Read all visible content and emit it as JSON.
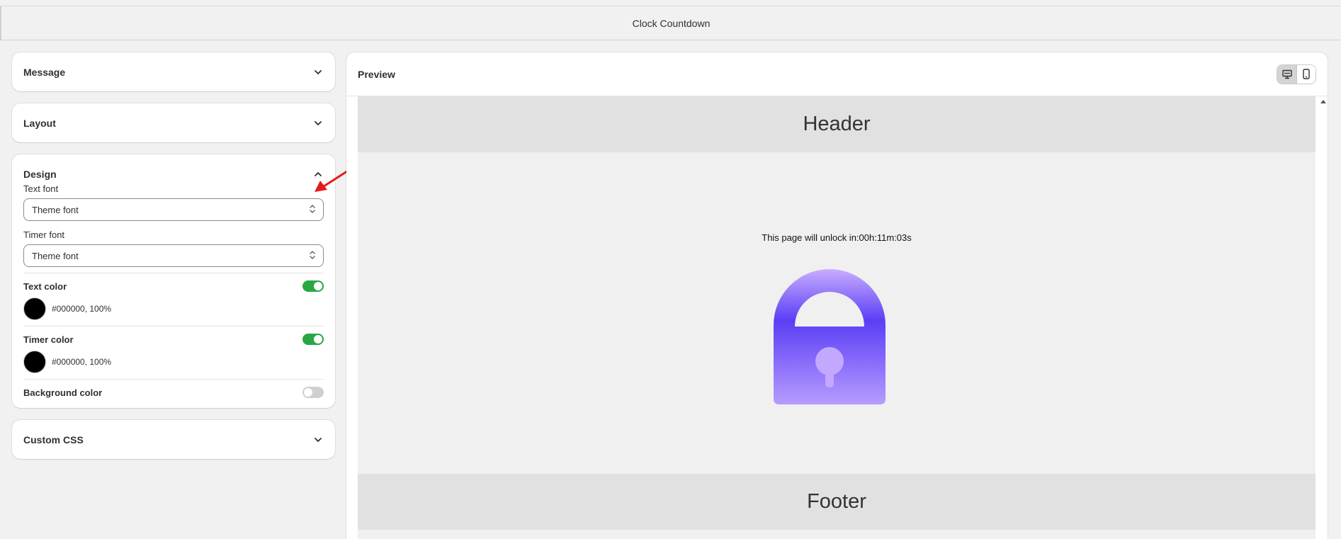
{
  "app": {
    "title": "Clock Countdown"
  },
  "sections": {
    "message": {
      "label": "Message"
    },
    "layout": {
      "label": "Layout"
    },
    "design": {
      "label": "Design",
      "text_font": {
        "label": "Text font",
        "value": "Theme font"
      },
      "timer_font": {
        "label": "Timer font",
        "value": "Theme font"
      },
      "text_color": {
        "label": "Text color",
        "value": "#000000, 100%",
        "enabled": true
      },
      "timer_color": {
        "label": "Timer color",
        "value": "#000000, 100%",
        "enabled": true
      },
      "background_color": {
        "label": "Background color",
        "enabled": false
      }
    },
    "custom_css": {
      "label": "Custom CSS"
    }
  },
  "preview": {
    "title": "Preview",
    "header_text": "Header",
    "footer_text": "Footer",
    "unlock_message": "This page will unlock in:00h:11m:03s",
    "device_modes": [
      "desktop-icon",
      "mobile-icon"
    ],
    "active_device": "desktop"
  },
  "colors": {
    "toggle_on": "#29a744",
    "lock_top": "#bca2ff",
    "lock_mid": "#5b3ef5",
    "annotation_arrow": "#e51b1b"
  }
}
